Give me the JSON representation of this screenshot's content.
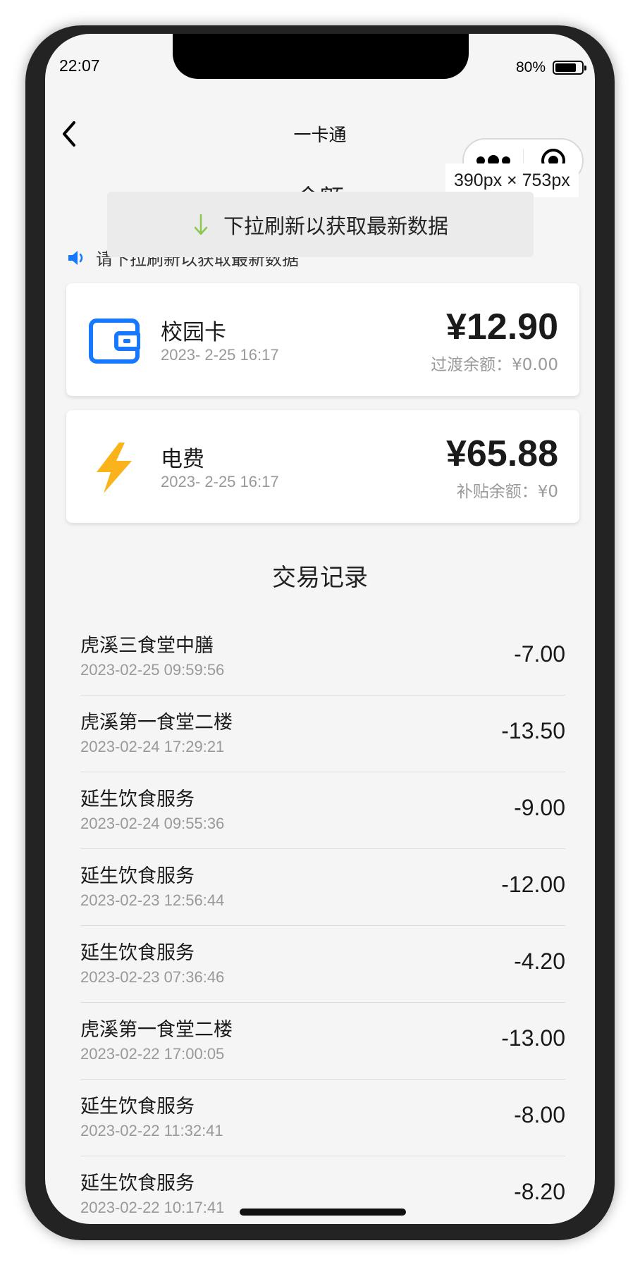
{
  "status": {
    "time": "22:07",
    "battery": "80%",
    "battery_level": 0.8
  },
  "nav": {
    "title": "一卡通"
  },
  "overlay": {
    "dimensions": "390px × 753px"
  },
  "partial_title": "余额",
  "refresh": {
    "text": "下拉刷新以获取最新数据"
  },
  "notice": {
    "text": "请下拉刷新以获取最新数据"
  },
  "cards": [
    {
      "name": "校园卡",
      "time": "2023- 2-25 16:17",
      "amount": "¥12.90",
      "sub": "过渡余额：¥0.00",
      "icon": "wallet-icon",
      "color": "#1677ff"
    },
    {
      "name": "电费",
      "time": "2023- 2-25 16:17",
      "amount": "¥65.88",
      "sub": "补贴余额：¥0",
      "icon": "lightning-icon",
      "color": "#fbb31c"
    }
  ],
  "transactions_title": "交易记录",
  "transactions": [
    {
      "name": "虎溪三食堂中膳",
      "time": "2023-02-25 09:59:56",
      "amount": "-7.00"
    },
    {
      "name": "虎溪第一食堂二楼",
      "time": "2023-02-24 17:29:21",
      "amount": "-13.50"
    },
    {
      "name": "延生饮食服务",
      "time": "2023-02-24 09:55:36",
      "amount": "-9.00"
    },
    {
      "name": "延生饮食服务",
      "time": "2023-02-23 12:56:44",
      "amount": "-12.00"
    },
    {
      "name": "延生饮食服务",
      "time": "2023-02-23 07:36:46",
      "amount": "-4.20"
    },
    {
      "name": "虎溪第一食堂二楼",
      "time": "2023-02-22 17:00:05",
      "amount": "-13.00"
    },
    {
      "name": "延生饮食服务",
      "time": "2023-02-22 11:32:41",
      "amount": "-8.00"
    },
    {
      "name": "延生饮食服务",
      "time": "2023-02-22 10:17:41",
      "amount": "-8.20"
    }
  ]
}
